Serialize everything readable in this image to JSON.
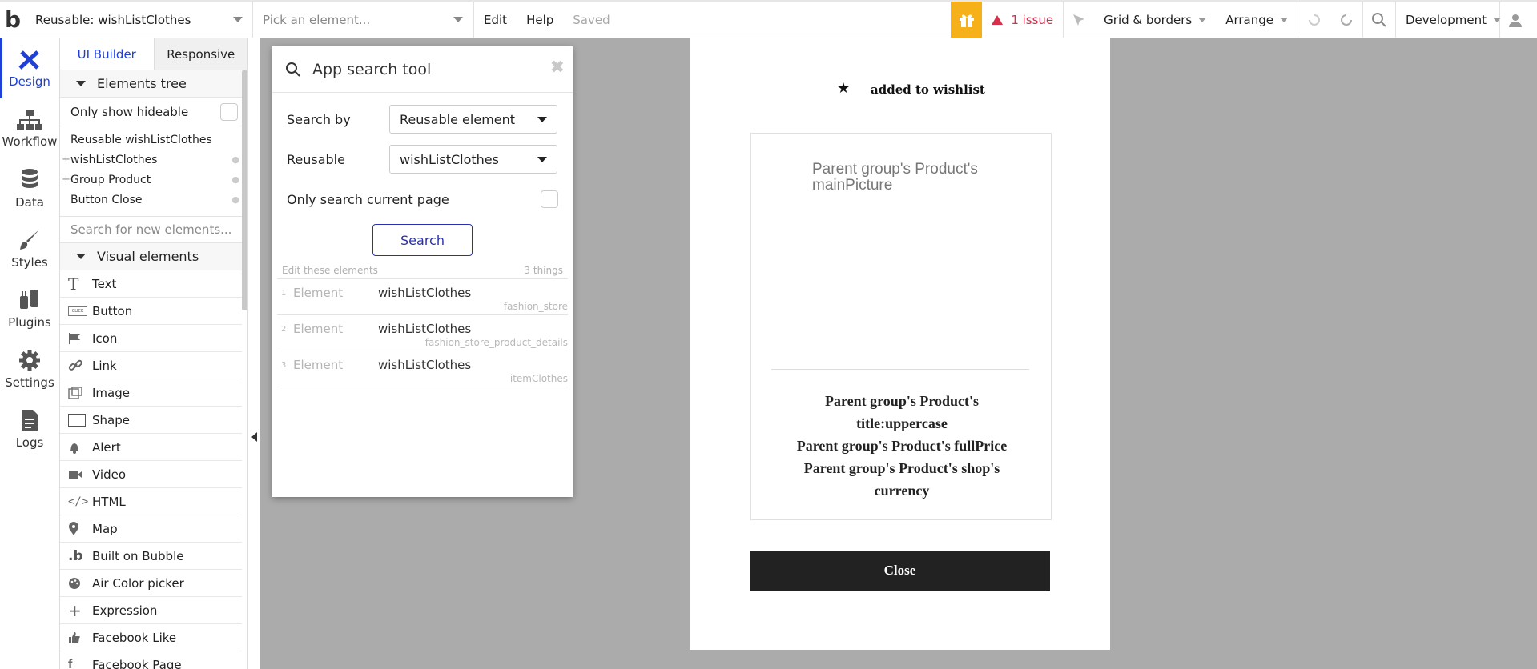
{
  "topbar": {
    "logo": "b",
    "page_selector": "Reusable: wishListClothes",
    "element_picker": "Pick an element...",
    "menu_edit": "Edit",
    "menu_help": "Help",
    "save_status": "Saved",
    "issues": "1 issue",
    "grid_borders": "Grid & borders",
    "arrange": "Arrange",
    "environment": "Development",
    "gift_color": "#f6b01a",
    "issue_color": "#d6304c"
  },
  "rail": {
    "items": [
      {
        "label": "Design",
        "icon": "design-icon"
      },
      {
        "label": "Workflow",
        "icon": "workflow-icon"
      },
      {
        "label": "Data",
        "icon": "database-icon"
      },
      {
        "label": "Styles",
        "icon": "brush-icon"
      },
      {
        "label": "Plugins",
        "icon": "plug-icon"
      },
      {
        "label": "Settings",
        "icon": "gear-icon"
      },
      {
        "label": "Logs",
        "icon": "document-icon"
      }
    ]
  },
  "palette": {
    "tabs": [
      "UI Builder",
      "Responsive"
    ],
    "elements_tree": "Elements tree",
    "only_show_hideable": "Only show hideable",
    "tree": [
      "Reusable wishListClothes",
      "wishListClothes",
      "Group Product",
      "Button Close"
    ],
    "search_placeholder": "Search for new elements...",
    "visual_elements": "Visual elements",
    "elements": [
      {
        "label": "Text",
        "icon": "text-icon"
      },
      {
        "label": "Button",
        "icon": "button-icon"
      },
      {
        "label": "Icon",
        "icon": "flag-icon"
      },
      {
        "label": "Link",
        "icon": "link-icon"
      },
      {
        "label": "Image",
        "icon": "image-icon"
      },
      {
        "label": "Shape",
        "icon": "shape-icon"
      },
      {
        "label": "Alert",
        "icon": "bell-icon"
      },
      {
        "label": "Video",
        "icon": "video-icon"
      },
      {
        "label": "HTML",
        "icon": "code-icon"
      },
      {
        "label": "Map",
        "icon": "map-pin-icon"
      },
      {
        "label": "Built on Bubble",
        "icon": "bubble-icon"
      },
      {
        "label": "Air Color picker",
        "icon": "palette-icon"
      },
      {
        "label": "Expression",
        "icon": "plus-icon"
      },
      {
        "label": "Facebook Like",
        "icon": "thumbs-up-icon"
      },
      {
        "label": "Facebook Page",
        "icon": "facebook-icon"
      }
    ],
    "accent": "#1e3fd8"
  },
  "search_tool": {
    "title": "App search tool",
    "search_by_label": "Search by",
    "search_by_value": "Reusable element",
    "reusable_label": "Reusable",
    "reusable_value": "wishListClothes",
    "only_current_page": "Only search current page",
    "search_button": "Search",
    "edit_these": "Edit these elements",
    "count": "3 things",
    "results": [
      {
        "num": "1",
        "kind": "Element",
        "name": "wishListClothes",
        "page": "fashion_store"
      },
      {
        "num": "2",
        "kind": "Element",
        "name": "wishListClothes",
        "page": "fashion_store_product_details"
      },
      {
        "num": "3",
        "kind": "Element",
        "name": "wishListClothes",
        "page": "itemClothes"
      }
    ]
  },
  "canvas": {
    "added_text": "added to wishlist",
    "main_picture": "Parent group's Product's mainPicture",
    "product_line1": "Parent group's Product's",
    "product_line2": "title:uppercase",
    "product_line3": "Parent group's Product's fullPrice",
    "product_line4": "Parent group's Product's shop's",
    "product_line5": "currency",
    "close_button": "Close"
  }
}
